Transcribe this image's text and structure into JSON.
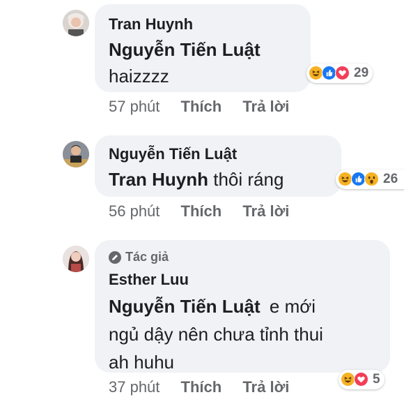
{
  "comments": [
    {
      "author": "Tran Huynh",
      "mention": "Nguyễn Tiến Luật",
      "text": "haizzzz",
      "time": "57 phút",
      "like": "Thích",
      "reply": "Trả lời",
      "reactions": {
        "icons": [
          "haha-icon",
          "like-icon",
          "love-icon"
        ],
        "count": "29"
      }
    },
    {
      "author": "Nguyễn Tiến Luật",
      "mention": "Tran Huynh",
      "text": "thôi ráng",
      "time": "56 phút",
      "like": "Thích",
      "reply": "Trả lời",
      "reactions": {
        "icons": [
          "haha-icon",
          "like-icon",
          "wow-icon"
        ],
        "count": "26"
      }
    },
    {
      "badge": "Tác giả",
      "author": "Esther Luu",
      "mention": "Nguyễn Tiến Luật",
      "text_line1": "e mới",
      "text_line2": "ngủ dậy nên chưa tỉnh thui",
      "text_line3": "ah huhu",
      "time": "37 phút",
      "like": "Thích",
      "reply": "Trả lời",
      "reactions": {
        "icons": [
          "haha-icon",
          "love-icon"
        ],
        "count": "5"
      }
    }
  ],
  "colors": {
    "bubble": "#f0f2f5",
    "meta_text": "#65676b",
    "like_blue": "#1877f2",
    "love_red": "#f33e58",
    "haha_yellow": "#f7b125"
  }
}
